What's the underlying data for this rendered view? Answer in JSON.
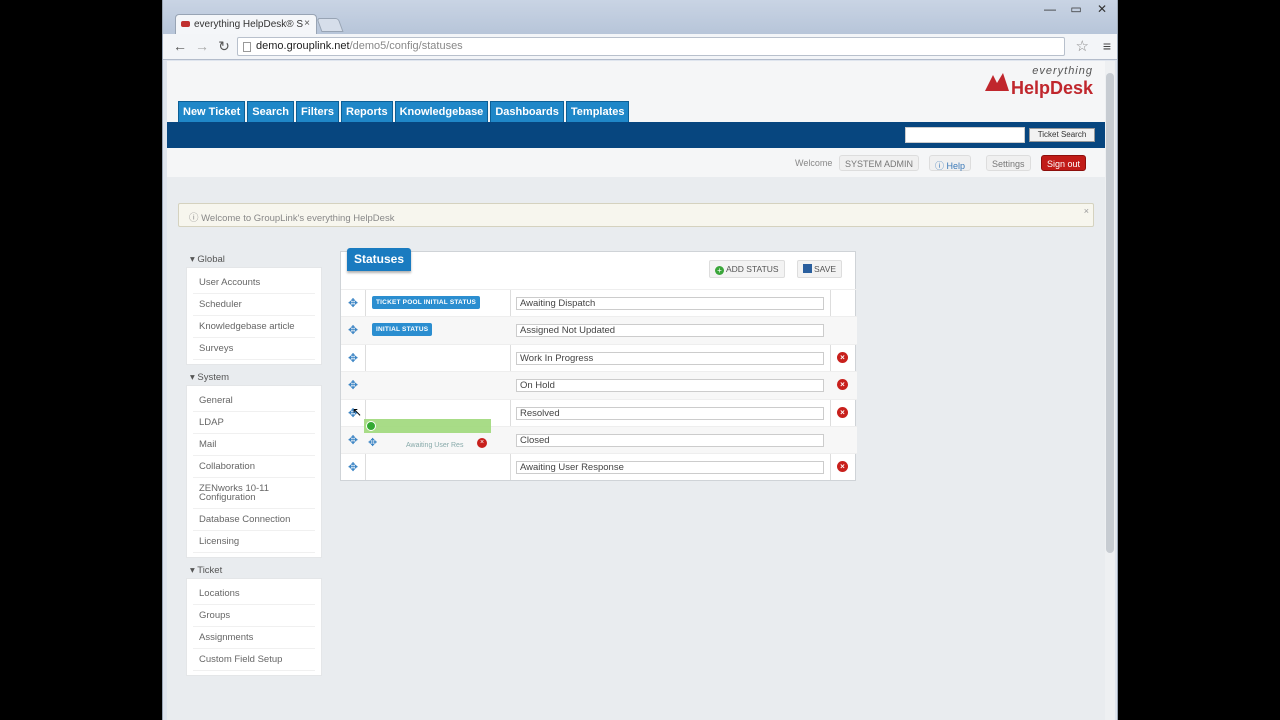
{
  "browser": {
    "tab_title": "everything HelpDesk® S",
    "tab_close": "×",
    "url_host": "demo.grouplink.net",
    "url_path": "/demo5/config/statuses",
    "win_min": "—",
    "win_max": "▭",
    "win_close": "✕"
  },
  "logo": {
    "line1": "everything",
    "line2": "HelpDesk"
  },
  "nav": {
    "items": [
      "New Ticket",
      "Search",
      "Filters",
      "Reports",
      "Knowledgebase",
      "Dashboards",
      "Templates"
    ]
  },
  "search": {
    "button": "Ticket Search",
    "value": ""
  },
  "userbar": {
    "welcome": "Welcome",
    "user": "SYSTEM ADMIN",
    "help": "Help",
    "settings": "Settings",
    "signout": "Sign out"
  },
  "notice": {
    "text": "Welcome to GroupLink's everything HelpDesk",
    "close": "×"
  },
  "sidebar": {
    "sections": [
      {
        "title": "Global",
        "items": [
          "User Accounts",
          "Scheduler",
          "Knowledgebase article",
          "Surveys"
        ]
      },
      {
        "title": "System",
        "items": [
          "General",
          "LDAP",
          "Mail",
          "Collaboration",
          "ZENworks 10-11 Configuration",
          "Database Connection",
          "Licensing"
        ]
      },
      {
        "title": "Ticket",
        "items": [
          "Locations",
          "Groups",
          "Assignments",
          "Custom Field Setup"
        ]
      }
    ]
  },
  "panel": {
    "title": "Statuses",
    "add_label": "ADD STATUS",
    "save_label": "SAVE",
    "rows": [
      {
        "badge": "TICKET POOL INITIAL STATUS",
        "value": "Awaiting Dispatch",
        "deletable": false
      },
      {
        "badge": "INITIAL STATUS",
        "value": "Assigned Not Updated",
        "deletable": false
      },
      {
        "badge": "",
        "value": "Work In Progress",
        "deletable": true
      },
      {
        "badge": "",
        "value": "On Hold",
        "deletable": true
      },
      {
        "badge": "",
        "value": "Resolved",
        "deletable": true
      },
      {
        "badge": "",
        "value": "Closed",
        "deletable": false
      },
      {
        "badge": "",
        "value": "Awaiting User Response",
        "deletable": true
      }
    ],
    "drag_label": "Awaiting User Res"
  }
}
